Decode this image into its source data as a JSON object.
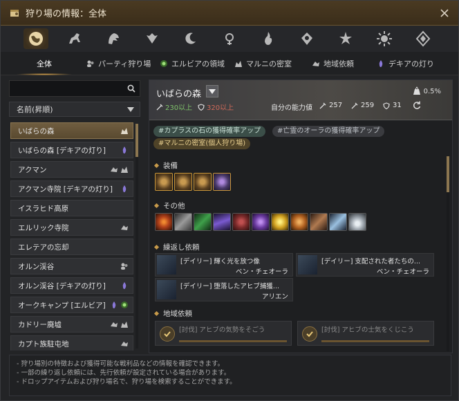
{
  "window": {
    "title": "狩り場の情報：全体"
  },
  "categories": [
    {
      "icon": "globe-icon",
      "active": true
    },
    {
      "icon": "horse-icon"
    },
    {
      "icon": "dragon-head-icon"
    },
    {
      "icon": "wing-emblem-icon"
    },
    {
      "icon": "crescent-moon-icon"
    },
    {
      "icon": "pendant-icon"
    },
    {
      "icon": "flame-emblem-icon"
    },
    {
      "icon": "bird-crest-icon"
    },
    {
      "icon": "star-crest-icon"
    },
    {
      "icon": "sun-crest-icon"
    },
    {
      "icon": "diamond-crest-icon"
    }
  ],
  "subtabs": [
    {
      "label": "全体",
      "icon": ""
    },
    {
      "label": "パーティ狩り場",
      "icon": "party-icon"
    },
    {
      "label": "エルビアの領域",
      "icon": "elvia-icon"
    },
    {
      "label": "マルニの密室",
      "icon": "marni-icon"
    },
    {
      "label": "地域依頼",
      "icon": "region-quest-icon"
    },
    {
      "label": "デキアの灯り",
      "icon": "dekia-icon"
    }
  ],
  "search": {
    "placeholder": ""
  },
  "sort": {
    "label": "名前(昇順)"
  },
  "zones": [
    {
      "name": "いばらの森",
      "tags": [
        "marni"
      ]
    },
    {
      "name": "いばらの森 [デキアの灯り]",
      "tags": [
        "dekia"
      ]
    },
    {
      "name": "アクマン",
      "tags": [
        "region",
        "marni"
      ]
    },
    {
      "name": "アクマン寺院 [デキアの灯り]",
      "tags": [
        "dekia"
      ]
    },
    {
      "name": "イスラヒド高原",
      "tags": []
    },
    {
      "name": "エルリック寺院",
      "tags": [
        "region"
      ]
    },
    {
      "name": "エレテアの忘却",
      "tags": []
    },
    {
      "name": "オルン渓谷",
      "tags": [
        "party"
      ]
    },
    {
      "name": "オルン渓谷 [デキアの灯り]",
      "tags": [
        "dekia"
      ]
    },
    {
      "name": "オークキャンプ [エルビア]",
      "tags": [
        "dekia",
        "elvia"
      ]
    },
    {
      "name": "カドリー廃墟",
      "tags": [
        "region",
        "marni"
      ]
    },
    {
      "name": "カプト族駐屯地",
      "tags": [
        "region"
      ]
    }
  ],
  "detail": {
    "zone_name": "いばらの森",
    "ap_required": "230以上",
    "dp_required": "320以上",
    "my_stats_label": "自分の能力値",
    "my_ap": "257",
    "my_awaken_ap": "259",
    "my_dp": "31",
    "drop_rate": "0.5%",
    "chips": [
      {
        "label": "#カプラスの石の獲得確率アップ",
        "style": "teal"
      },
      {
        "label": "#亡霊のオーラの獲得確率アップ",
        "style": "gray"
      },
      {
        "label": "#マルニの密室(個人狩り場)",
        "style": "gold"
      }
    ],
    "sections": {
      "equipment": "装備",
      "other": "その他",
      "repeat_quests": "繰返し依頼",
      "region_quests": "地域依頼"
    },
    "equipment_items": [
      {
        "icon": "ring-icon",
        "color": "#7a5a30"
      },
      {
        "icon": "ring-icon",
        "color": "#7a5a30"
      },
      {
        "icon": "ring-icon",
        "color": "#7a5a30"
      },
      {
        "icon": "gem-ring-icon",
        "color": "#4a3a6a"
      }
    ],
    "other_items": [
      {
        "icon": "fire-orb-icon",
        "color": "#b0401a"
      },
      {
        "icon": "claw-icon",
        "color": "#707070"
      },
      {
        "icon": "green-shard-icon",
        "color": "#2f7a3a"
      },
      {
        "icon": "purple-crystal-icon",
        "color": "#5a3a8a"
      },
      {
        "icon": "red-stone-icon",
        "color": "#7a2a2a"
      },
      {
        "icon": "violet-ore-icon",
        "color": "#6a3aa0"
      },
      {
        "icon": "yellow-gem-icon",
        "color": "#d0a020"
      },
      {
        "icon": "amber-drop-icon",
        "color": "#b06020"
      },
      {
        "icon": "bone-icon",
        "color": "#8a5a3a"
      },
      {
        "icon": "potion-icon",
        "color": "#5a7a9a"
      },
      {
        "icon": "salt-pile-icon",
        "color": "#a0a8b0"
      }
    ],
    "repeat_quests": [
      {
        "title": "[デイリー] 輝く光を放つ像",
        "npc": "ベン・チェオーラ"
      },
      {
        "title": "[デイリー] 支配された者たちの...",
        "npc": "ベン・チェオーラ"
      },
      {
        "title": "[デイリー] 堕落したアヒブ捕獲...",
        "npc": "アリエン"
      }
    ],
    "region_quests": [
      {
        "title": "[討伐] アヒブの気勢をそごう"
      },
      {
        "title": "[討伐] アヒブの士気をくじこう"
      }
    ]
  },
  "footer": {
    "lines": [
      "- 狩り場別の特徴および獲得可能な戦利品などの情報を確認できます。",
      "- 一部の繰り返し依頼には、先行依頼が設定されている場合があります。",
      "- ドロップアイテムおよび狩り場名で、狩り場を検索することができます。"
    ]
  }
}
